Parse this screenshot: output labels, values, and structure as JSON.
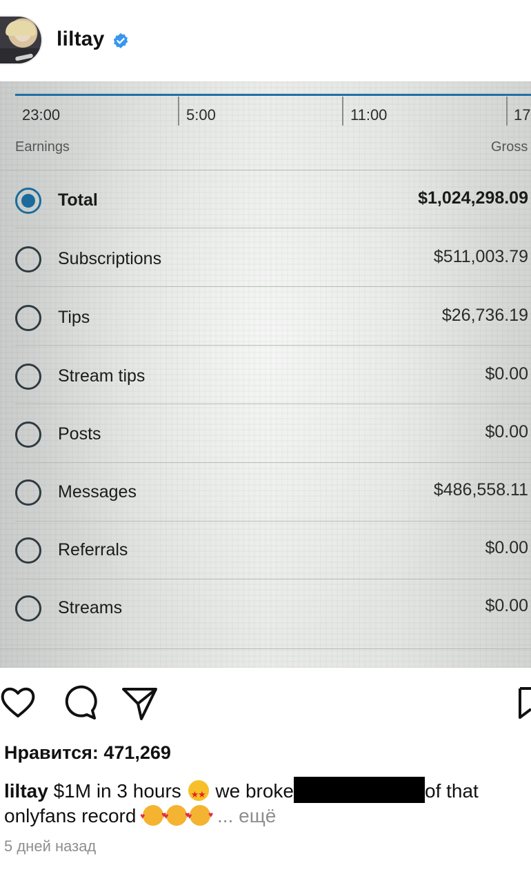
{
  "header": {
    "username": "liltay",
    "verified_icon": "verified-badge-icon",
    "accent": "#3797f0"
  },
  "photo": {
    "chart_times": [
      "23:00",
      "5:00",
      "11:00",
      "17"
    ],
    "col_left": "Earnings",
    "col_right": "Gross",
    "rows": [
      {
        "label": "Total",
        "value": "$1,024,298.09",
        "selected": true
      },
      {
        "label": "Subscriptions",
        "value": "$511,003.79",
        "selected": false
      },
      {
        "label": "Tips",
        "value": "$26,736.19",
        "selected": false
      },
      {
        "label": "Stream tips",
        "value": "$0.00",
        "selected": false
      },
      {
        "label": "Posts",
        "value": "$0.00",
        "selected": false
      },
      {
        "label": "Messages",
        "value": "$486,558.11",
        "selected": false
      },
      {
        "label": "Referrals",
        "value": "$0.00",
        "selected": false
      },
      {
        "label": "Streams",
        "value": "$0.00",
        "selected": false
      }
    ],
    "accent": "#1b6b9c"
  },
  "actions": {
    "icons": [
      "heart-icon",
      "comment-icon",
      "share-icon",
      "bookmark-icon"
    ]
  },
  "likes": {
    "text": "Нравится: 471,269"
  },
  "caption": {
    "user": "liltay",
    "part1": " $1M in 3 hours ",
    "part2": " we broke",
    "part3": "of that onlyfans record ",
    "more": "... ещё"
  },
  "time_ago": "5 дней назад"
}
